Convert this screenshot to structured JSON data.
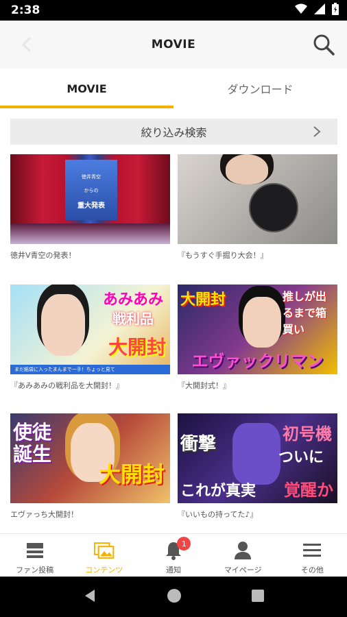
{
  "status_bar": {
    "time": "2:38"
  },
  "header": {
    "title": "MOVIE"
  },
  "tabs": [
    {
      "label": "MOVIE",
      "active": true
    },
    {
      "label": "ダウンロード",
      "active": false
    }
  ],
  "filter": {
    "label": "絞り込み検索"
  },
  "videos": [
    {
      "caption": "徳井V青空の発表！",
      "thumb_text": [
        "徳井青空",
        "からの",
        "重大発表"
      ]
    },
    {
      "caption": "『もうすぐ手掘り大会！』"
    },
    {
      "caption": "『あみあみの戦利品を大開封！』",
      "thumb_text": [
        "あみあみ",
        "戦利品",
        "大開封",
        "まだ紙袋に入ったまんまで一手！ちょっと見て"
      ]
    },
    {
      "caption": "『大開封式！』",
      "thumb_text": [
        "大開封",
        "推しが出るまで箱買い",
        "エヴァックリマン"
      ]
    },
    {
      "caption": "エヴァっち大開封！",
      "thumb_text": [
        "使徒誕生",
        "大開封"
      ]
    },
    {
      "caption": "『いいもの持ってた♪』",
      "thumb_text": [
        "衝撃",
        "初号機",
        "ついに",
        "これが真実",
        "覚醒か"
      ]
    }
  ],
  "bottom_nav": [
    {
      "label": "ファン投稿",
      "active": false
    },
    {
      "label": "コンテンツ",
      "active": true
    },
    {
      "label": "通知",
      "active": false,
      "badge": "1"
    },
    {
      "label": "マイページ",
      "active": false
    },
    {
      "label": "その他",
      "active": false
    }
  ],
  "colors": {
    "accent": "#f5b100",
    "badge": "#f04545"
  }
}
